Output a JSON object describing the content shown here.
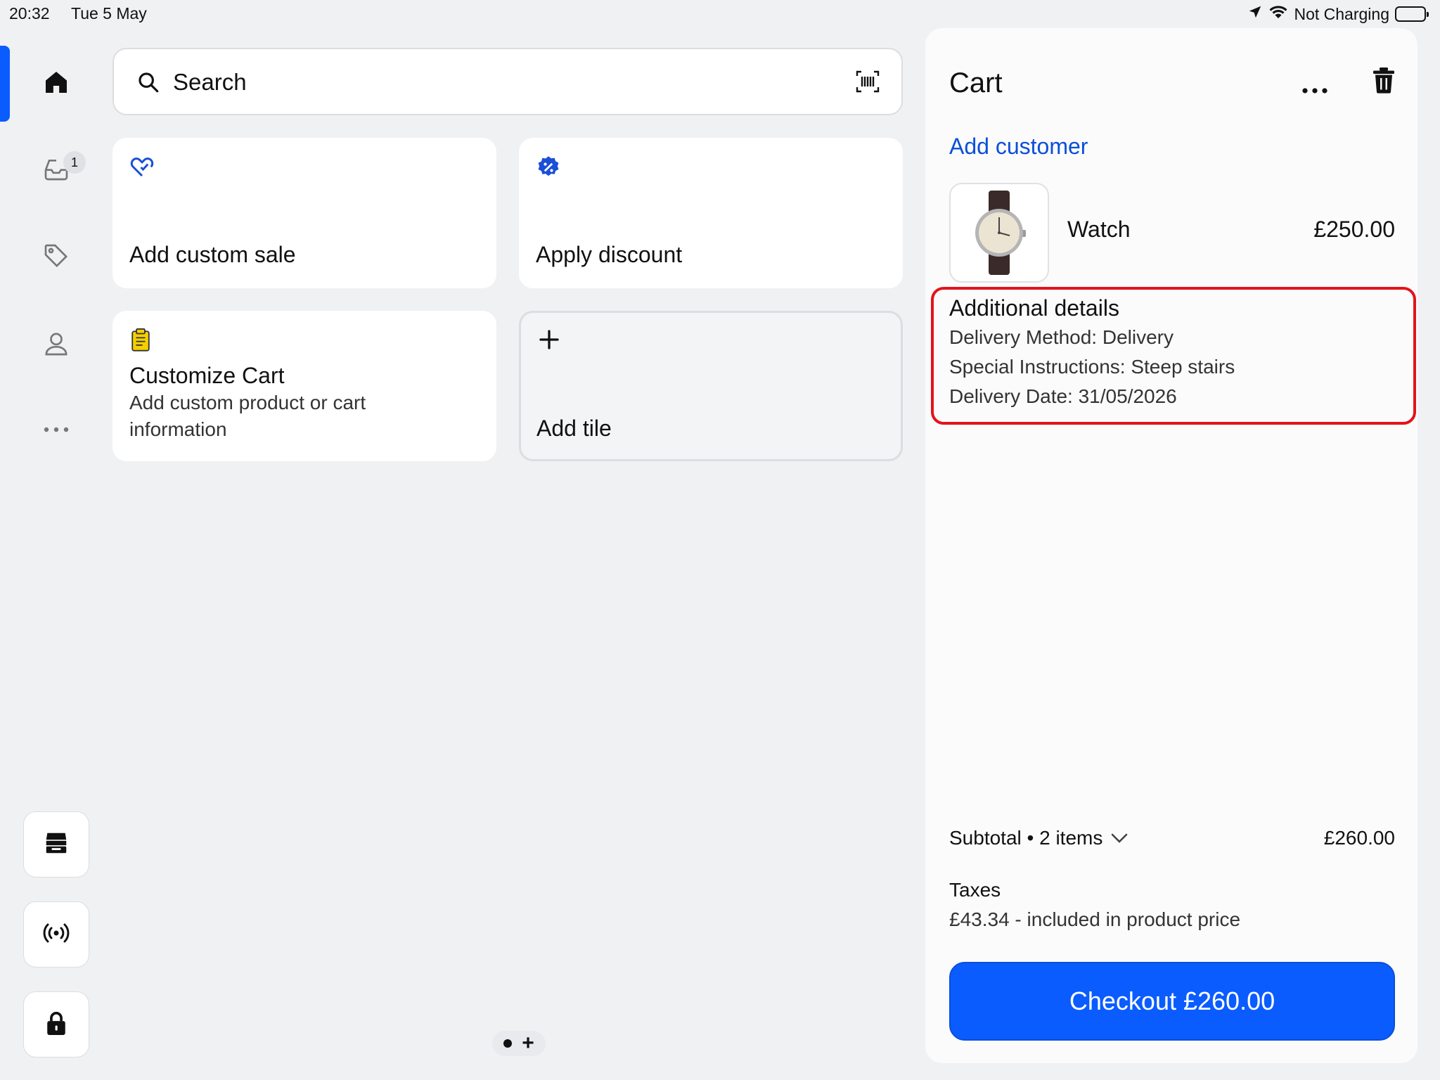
{
  "status_bar": {
    "time": "20:32",
    "date": "Tue 5 May",
    "charging": "Not Charging"
  },
  "sidebar": {
    "items": [
      {
        "icon": "home-icon",
        "active": true
      },
      {
        "icon": "inbox-icon",
        "badge": "1"
      },
      {
        "icon": "tag-icon"
      },
      {
        "icon": "person-icon"
      },
      {
        "icon": "more-icon"
      }
    ],
    "bottom_buttons": [
      "store-icon",
      "broadcast-icon",
      "lock-icon"
    ]
  },
  "search": {
    "label": "Search"
  },
  "tiles": [
    {
      "title": "Add custom sale",
      "icon": "tag-edit-icon"
    },
    {
      "title": "Apply discount",
      "icon": "discount-badge-icon"
    },
    {
      "title": "Customize Cart",
      "subtitle": "Add custom product or cart information",
      "icon": "clipboard-icon"
    },
    {
      "title": "Add tile",
      "icon": "plus-icon"
    }
  ],
  "pager": {
    "plus": "+"
  },
  "cart": {
    "title": "Cart",
    "add_customer": "Add customer",
    "item": {
      "name": "Watch",
      "price": "£250.00"
    },
    "details": {
      "title": "Additional details",
      "lines": [
        "Delivery Method: Delivery",
        "Special Instructions: Steep stairs",
        "Delivery Date: 31/05/2026"
      ]
    },
    "subtotal_label": "Subtotal • 2 items",
    "subtotal_value": "£260.00",
    "taxes_label": "Taxes",
    "taxes_sub": "£43.34 - included in product price",
    "checkout_label": "Checkout £260.00"
  },
  "colors": {
    "accent": "#0a5cff",
    "link": "#0a4fd8",
    "highlight": "#e3141b",
    "tag_icon": "#1a4fd6",
    "clipboard": "#f5d000"
  }
}
